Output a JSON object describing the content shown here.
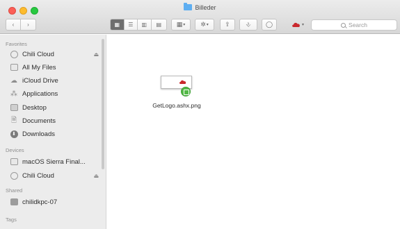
{
  "window": {
    "title": "Billeder"
  },
  "toolbar": {
    "back": "‹",
    "forward": "›",
    "search_placeholder": "Search",
    "view_icons": [
      "icon-view",
      "list-view",
      "column-view",
      "cover-flow-view"
    ],
    "arrange_icon": "arrange-icon",
    "action_icon": "gear-icon",
    "share_icon": "share-icon",
    "tag_icon": "tag-icon",
    "chili_icon": "chili-cloud-icon"
  },
  "sidebar": {
    "favorites": {
      "label": "Favorites",
      "items": [
        {
          "label": "Chili Cloud",
          "icon": "cloud-drive-icon"
        },
        {
          "label": "All My Files",
          "icon": "all-files-icon"
        },
        {
          "label": "iCloud Drive",
          "icon": "icloud-icon"
        },
        {
          "label": "Applications",
          "icon": "applications-icon"
        },
        {
          "label": "Desktop",
          "icon": "desktop-icon"
        },
        {
          "label": "Documents",
          "icon": "documents-icon"
        },
        {
          "label": "Downloads",
          "icon": "downloads-icon"
        }
      ]
    },
    "devices": {
      "label": "Devices",
      "items": [
        {
          "label": "macOS Sierra Final...",
          "icon": "disk-icon"
        },
        {
          "label": "Chili Cloud",
          "icon": "cloud-drive-icon"
        }
      ]
    },
    "shared": {
      "label": "Shared",
      "items": [
        {
          "label": "chilidkpc-07",
          "icon": "computer-icon"
        }
      ]
    },
    "tags": {
      "label": "Tags"
    }
  },
  "content": {
    "file": {
      "name": "GetLogo.ashx.png",
      "badge": "synced-badge-icon"
    }
  },
  "colors": {
    "accent_red": "#c9282d",
    "folder_blue": "#5eaef1",
    "sync_green": "#53b947"
  }
}
